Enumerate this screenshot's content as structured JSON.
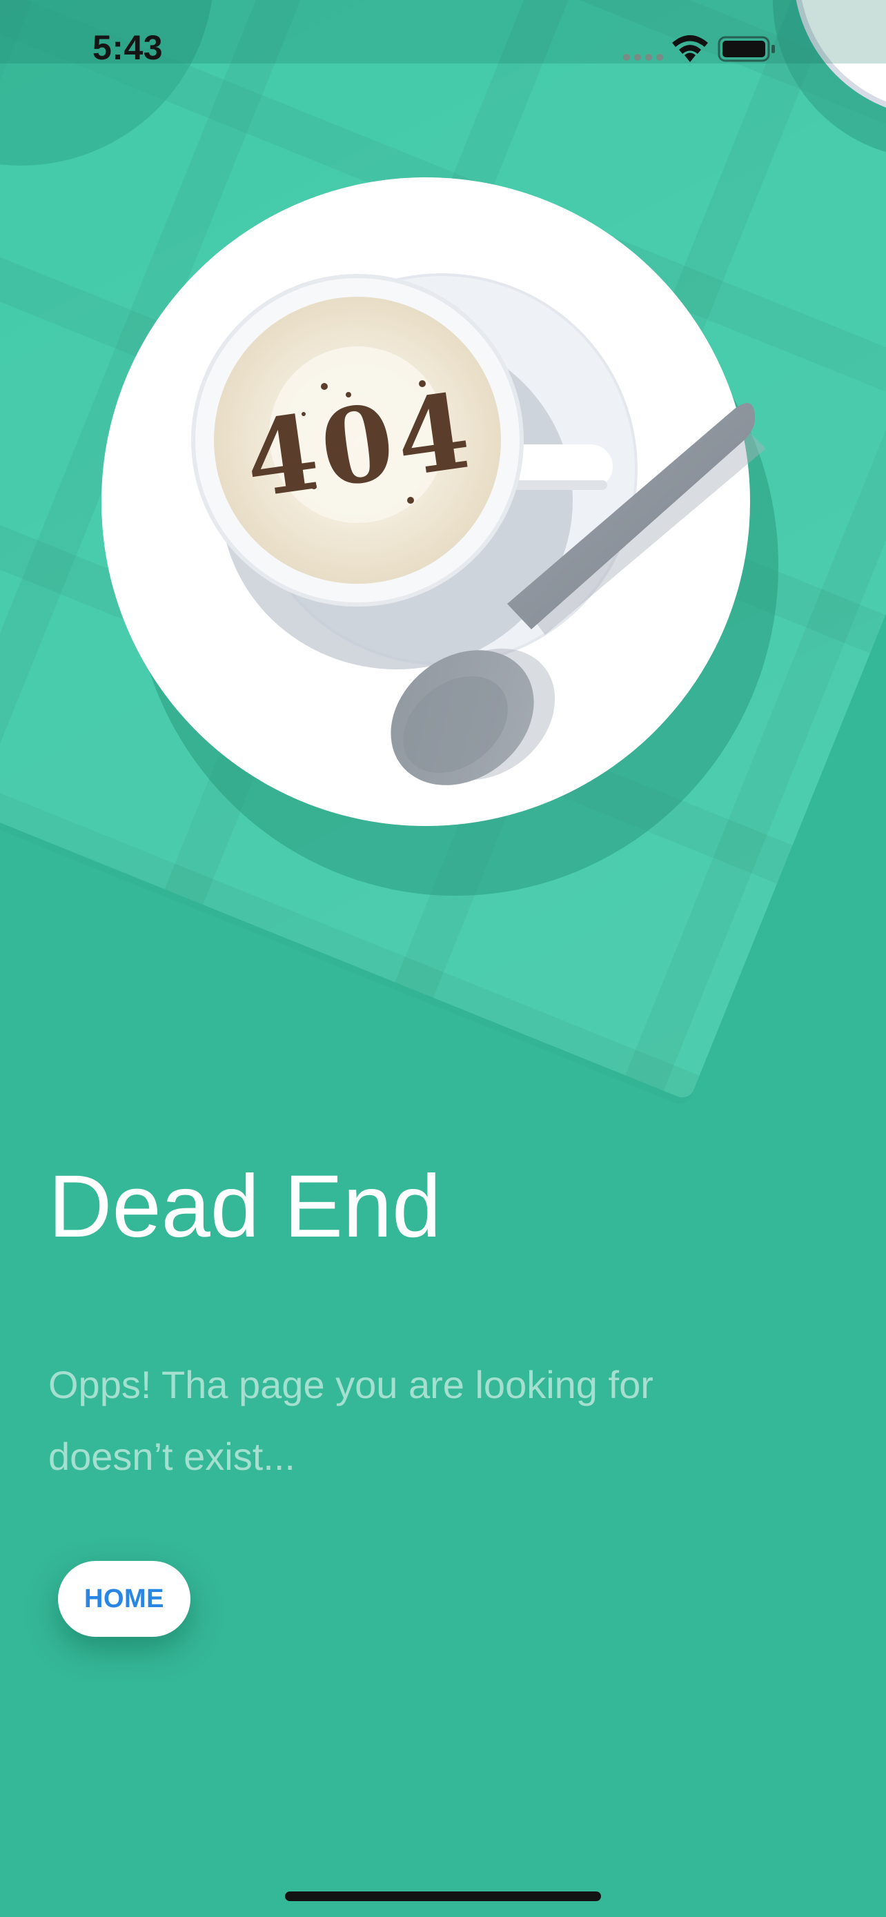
{
  "status_bar": {
    "time": "5:43"
  },
  "illustration": {
    "art_text": "404",
    "icons": [
      "coffee-cup-icon",
      "spoon-icon",
      "saucer-icon"
    ]
  },
  "main": {
    "title": "Dead End",
    "message": "Opps! Tha page you are looking for doesn’t exist...",
    "home_button_label": "HOME"
  },
  "colors": {
    "background": "#35b898",
    "tablecloth": "#3fc9a7",
    "accent": "#2a86e3",
    "title_text": "#ffffff"
  }
}
